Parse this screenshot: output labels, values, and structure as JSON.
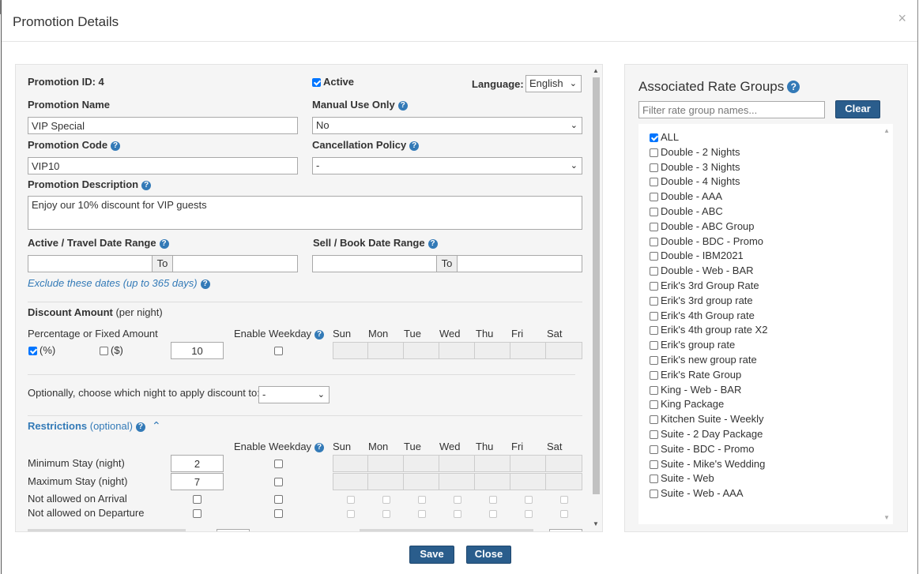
{
  "header": {
    "title": "Promotion Details",
    "close_glyph": "×"
  },
  "form": {
    "promotion_id_label": "Promotion ID: 4",
    "active_label": "Active",
    "language_label": "Language:",
    "language_value": "English",
    "name_label": "Promotion Name",
    "name_value": "VIP Special",
    "manual_use_label": "Manual Use Only",
    "manual_use_value": "No",
    "code_label": "Promotion Code",
    "code_value": "VIP10",
    "cancellation_label": "Cancellation Policy",
    "cancellation_value": "-",
    "description_label": "Promotion Description",
    "description_value": "Enjoy our 10% discount for VIP  guests",
    "travel_range_label": "Active / Travel Date Range",
    "sell_range_label": "Sell / Book Date Range",
    "to_label": "To",
    "exclude_link": "Exclude these dates (up to 365 days)",
    "discount_label": "Discount Amount",
    "discount_suffix": " (per night)",
    "pct_fixed_label": "Percentage or Fixed Amount",
    "pct_label": "(%)",
    "fixed_label": "($)",
    "amount_value": "10",
    "enable_weekday_label": "Enable Weekday",
    "days": [
      "Sun",
      "Mon",
      "Tue",
      "Wed",
      "Thu",
      "Fri",
      "Sat"
    ],
    "night_label": "Optionally, choose which night to apply discount to:",
    "night_value": "-",
    "restrictions_label": "Restrictions",
    "restrictions_optional": " (optional)",
    "min_stay_label": "Minimum Stay (night)",
    "min_stay_value": "2",
    "max_stay_label": "Maximum Stay (night)",
    "max_stay_value": "7",
    "not_arrival_label": "Not allowed on Arrival",
    "not_departure_label": "Not allowed on Departure"
  },
  "rate_groups": {
    "title": "Associated Rate Groups",
    "filter_placeholder": "Filter rate group names...",
    "clear_label": "Clear",
    "items": [
      "ALL",
      "Double - 2 Nights",
      "Double - 3 Nights",
      "Double - 4 Nights",
      "Double - AAA",
      "Double - ABC",
      "Double - ABC Group",
      "Double - BDC - Promo",
      "Double - IBM2021",
      "Double - Web - BAR",
      "Erik's 3rd Group Rate",
      "Erik's 3rd group rate",
      "Erik's 4th Group rate",
      "Erik's 4th group rate X2",
      "Erik's group rate",
      "Erik's new group rate",
      "Erik's Rate Group",
      "King - Web - BAR",
      "King Package",
      "Kitchen Suite - Weekly",
      "Suite - 2 Day Package",
      "Suite - BDC - Promo",
      "Suite - Mike's Wedding",
      "Suite - Web",
      "Suite - Web - AAA"
    ],
    "checked": [
      "ALL"
    ]
  },
  "footer": {
    "save_label": "Save",
    "close_label": "Close"
  },
  "colors": {
    "accent": "#337ab7",
    "button": "#2a5d8c",
    "checkbox": "#0075ff"
  }
}
